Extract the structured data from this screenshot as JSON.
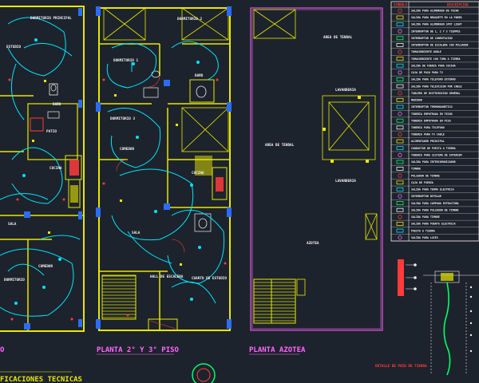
{
  "drawing_labels": {
    "plan_2_3": "PLANTA 2° Y 3° PISO",
    "plan_roof": "PLANTA AZOTEA",
    "plan_1_partial": "O",
    "specs": "FICACIONES TECNICAS",
    "detail_pit": "DETALLE DE POZO DE TIERRA"
  },
  "room_labels": {
    "left": [
      "DORMITORIO PRINCIPAL",
      "BAÑO",
      "PATIO",
      "COCINA",
      "COMEDOR",
      "DORMITORIO",
      "ESTUDIO",
      "SALA"
    ],
    "middle": [
      "DORMITORIO 1",
      "DORMITORIO 2",
      "DORMITORIO 3",
      "BAÑO",
      "COMEDOR",
      "COCINA",
      "SALA",
      "HALL DE ESCALERA",
      "CUARTO DE ESTUDIO"
    ],
    "right": [
      "AREA DE TENDAL",
      "AREA DE TENDAL",
      "LAVANDERIA",
      "LAVANDERIA",
      "AZOTEA"
    ]
  },
  "legend": {
    "header_symbol": "SIMBOLO",
    "header_description": "DESCRIPCION",
    "rows": [
      "SALIDA PARA ALUMBRADO DE TECHO",
      "SALIDA PARA BRAQUETE EN LA PARED",
      "SALIDA PARA ALUMBRADO SPOT LIGHT",
      "INTERRUPTOR DE 1, 2 Y 3 TIEMPOS",
      "INTERRUPTOR DE CONMUTACION",
      "INTERRUPTOR DE ESCALERA CON PULSADOR",
      "TOMACORRIENTE DOBLE",
      "TOMACORRIENTE CON TOMA A TIERRA",
      "SALIDA DE FUERZA PARA COCINA",
      "CAJA DE PASO PARA TV",
      "SALIDA PARA TELEFONO EXTERNO",
      "SALIDA PARA TELEVISION POR CABLE",
      "TABLERO DE DISTRIBUCION GENERAL",
      "MEDIDOR",
      "INTERRUPTOR TERMOMAGNETICO",
      "TUBERIA EMPOTRADA EN TECHO",
      "TUBERIA EMPOTRADA EN PISO",
      "TUBERIA PARA TELEFONO",
      "TUBERIA PARA TV CABLE",
      "ALIMENTADOR PRINCIPAL",
      "CONDUCTOR DE PUESTA A TIERRA",
      "TUBERIA PARA SISTEMA DE INTERCOM",
      "SALIDA PARA INTERCOMUNICADOR",
      "TIMBRE",
      "PULSADOR DE TIMBRE",
      "CAJA DE FUERZA",
      "SALIDA PARA TERMA ELECTRICA",
      "INTERRUPTOR BIPOLAR",
      "SALIDA PARA CAMPANA EXTRACTORA",
      "SALIDA PARA PULSADOR DE TIMBRE",
      "SALIDA PARA TIMBRE",
      "SALIDA PARA PUERTA ELECTRICA",
      "PUESTA A TIERRA",
      "SALIDA PARA LUCES"
    ]
  },
  "colors": {
    "background": "#1d232c",
    "wall": "#e8e800",
    "grid_frame": "#2b6cff",
    "circuit": "#00e5ff",
    "fixture": "#ff3b3b",
    "title": "#ff66ff",
    "text": "#f0f0f0"
  }
}
